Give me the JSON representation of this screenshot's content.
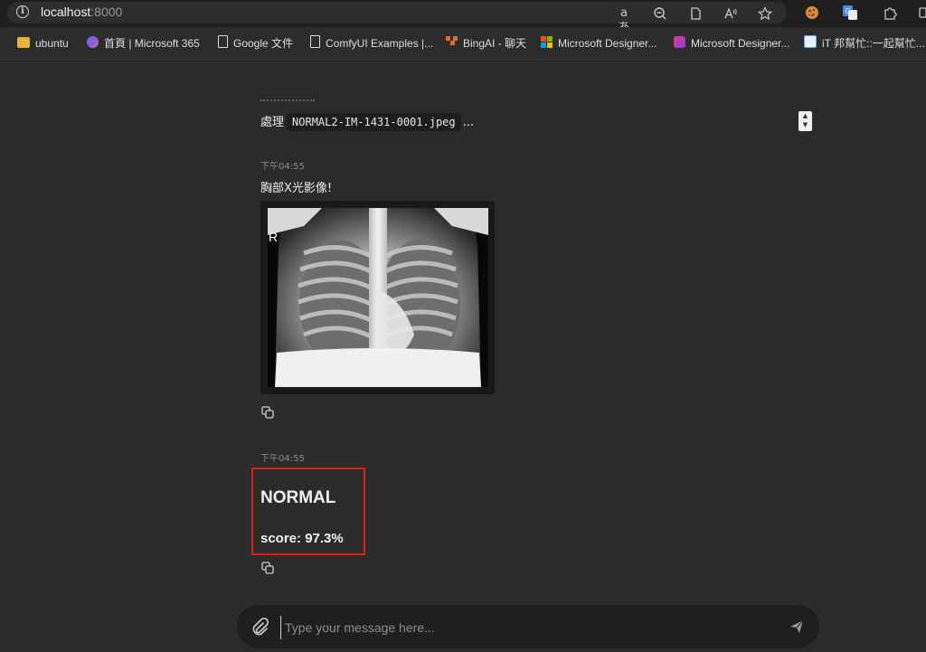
{
  "browser": {
    "url_host": "localhost",
    "url_port": ":8000",
    "translate_icon": "aあ"
  },
  "bookmarks": [
    {
      "label": "ubuntu",
      "icon": "folder-icon"
    },
    {
      "label": "首頁 | Microsoft 365",
      "icon": "microsoft365-icon"
    },
    {
      "label": "Google 文件",
      "icon": "page-icon"
    },
    {
      "label": "ComfyUI Examples |...",
      "icon": "page-icon"
    },
    {
      "label": "BingAI - 聊天",
      "icon": "bingai-icon"
    },
    {
      "label": "Microsoft Designer...",
      "icon": "microsoft-icon"
    },
    {
      "label": "Microsoft Designer...",
      "icon": "designer-icon"
    },
    {
      "label": "iT 邦幫忙::一起幫忙...",
      "icon": "ithelp-icon"
    }
  ],
  "chat": {
    "processing_prefix": "處理",
    "processing_file": "NORMAL2-IM-1431-0001.jpeg",
    "processing_suffix": "...",
    "messages": [
      {
        "time": "下午04:55",
        "text": "胸部X光影像!"
      },
      {
        "time": "下午04:55",
        "result_label": "NORMAL",
        "score_text": "score: 97.3%"
      }
    ],
    "xray_marker": "R"
  },
  "input": {
    "placeholder": "Type your message here..."
  },
  "colors": {
    "background": "#2b2b2b",
    "highlight_box": "#e01b1b",
    "input_bar": "#1f1f1f"
  }
}
